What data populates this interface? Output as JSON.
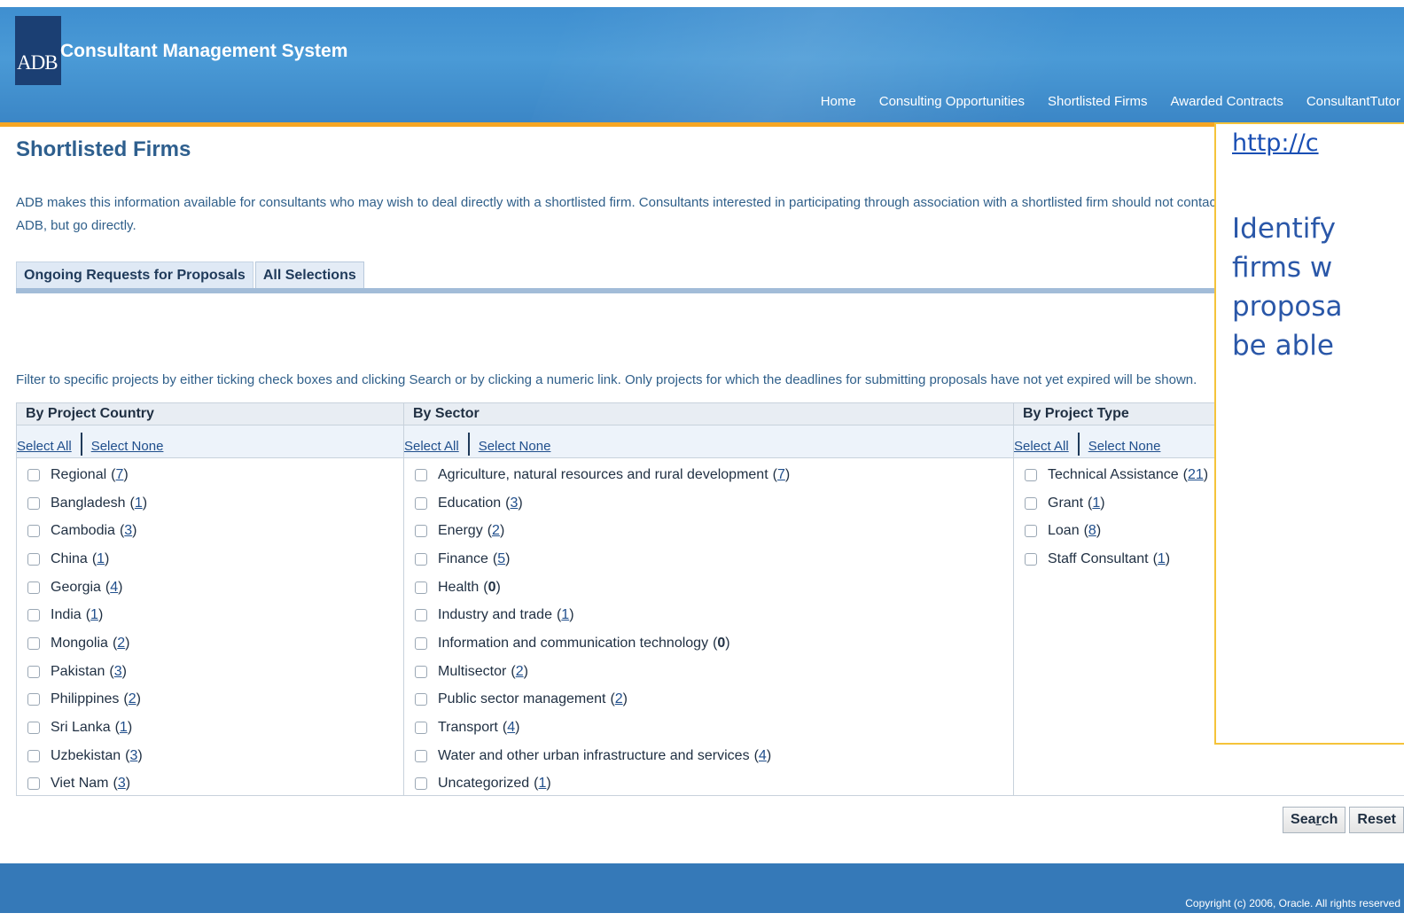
{
  "header": {
    "logo_text": "ADB",
    "app_title": "Consultant Management System",
    "nav": [
      "Home",
      "Consulting Opportunities",
      "Shortlisted Firms",
      "Awarded Contracts",
      "ConsultantTutor"
    ]
  },
  "page": {
    "title": "Shortlisted Firms",
    "intro": "ADB makes this information available for consultants who may wish to deal directly with a shortlisted firm. Consultants interested in participating through association with a shortlisted firm should not contact ADB, but go directly.",
    "tabs": [
      "Ongoing Requests for Proposals",
      "All Selections"
    ],
    "filter_note": "Filter to specific projects by either ticking check boxes and clicking Search or by clicking a numeric link. Only projects for which the deadlines for submitting proposals have not yet expired will be shown."
  },
  "filters": {
    "select_all": "Select All",
    "select_none": "Select None",
    "country": {
      "heading": "By Project Country",
      "items": [
        {
          "label": "Regional",
          "count": "7"
        },
        {
          "label": "Bangladesh",
          "count": "1"
        },
        {
          "label": "Cambodia",
          "count": "3"
        },
        {
          "label": "China",
          "count": "1"
        },
        {
          "label": "Georgia",
          "count": "4"
        },
        {
          "label": "India",
          "count": "1"
        },
        {
          "label": "Mongolia",
          "count": "2"
        },
        {
          "label": "Pakistan",
          "count": "3"
        },
        {
          "label": "Philippines",
          "count": "2"
        },
        {
          "label": "Sri Lanka",
          "count": "1"
        },
        {
          "label": "Uzbekistan",
          "count": "3"
        },
        {
          "label": "Viet Nam",
          "count": "3"
        }
      ]
    },
    "sector": {
      "heading": "By Sector",
      "items": [
        {
          "label": "Agriculture, natural resources and rural development",
          "count": "7"
        },
        {
          "label": "Education",
          "count": "3"
        },
        {
          "label": "Energy",
          "count": "2"
        },
        {
          "label": "Finance",
          "count": "5"
        },
        {
          "label": "Health",
          "count": "0"
        },
        {
          "label": "Industry and trade",
          "count": "1"
        },
        {
          "label": "Information and communication technology",
          "count": "0"
        },
        {
          "label": "Multisector",
          "count": "2"
        },
        {
          "label": "Public sector management",
          "count": "2"
        },
        {
          "label": "Transport",
          "count": "4"
        },
        {
          "label": "Water and other urban infrastructure and services",
          "count": "4"
        },
        {
          "label": "Uncategorized",
          "count": "1"
        }
      ]
    },
    "type": {
      "heading": "By Project Type",
      "items": [
        {
          "label": "Technical Assistance",
          "count": "21"
        },
        {
          "label": "Grant",
          "count": "1"
        },
        {
          "label": "Loan",
          "count": "8"
        },
        {
          "label": "Staff Consultant",
          "count": "1"
        }
      ]
    }
  },
  "buttons": {
    "search_prefix": "Sea",
    "search_key": "r",
    "search_suffix": "ch",
    "reset": "Reset"
  },
  "footer": {
    "copyright": "Copyright (c) 2006, Oracle. All rights reserved"
  },
  "callout": {
    "url": "http://c",
    "lines": [
      "Identify",
      "firms w",
      "proposa",
      "be able"
    ]
  },
  "colors": {
    "header": "#4a9ad6",
    "accent_bar": "#f6a623",
    "link": "#1f4e8c",
    "callout_border": "#f5c33a"
  }
}
